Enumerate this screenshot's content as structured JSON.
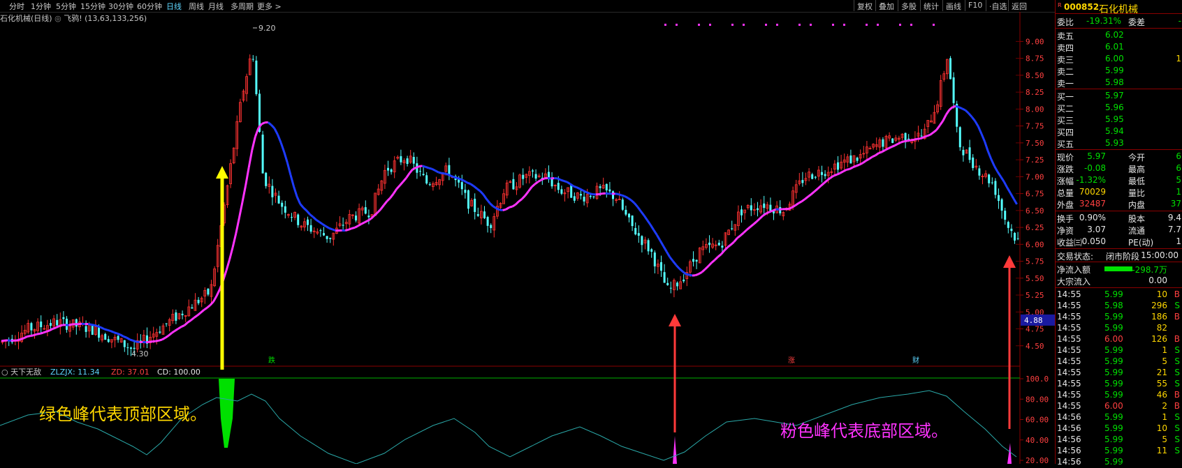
{
  "toolbar": {
    "left": [
      "分时",
      "1分钟",
      "5分钟",
      "15分钟",
      "30分钟",
      "60分钟",
      "日线",
      "周线",
      "月线",
      "多周期",
      "更多 >"
    ],
    "active": "日线",
    "right": [
      "复权",
      "叠加",
      "多股",
      "统计",
      "画线",
      "F10",
      "·自选",
      "返回"
    ]
  },
  "info": {
    "title": "石化机械(日线)",
    "indicator": "飞鸦!",
    "params": "(13,63,133,256)"
  },
  "chart_data": [
    {
      "type": "candlestick",
      "yticks": [
        4.5,
        4.75,
        5.0,
        5.25,
        5.5,
        5.75,
        6.0,
        6.25,
        6.5,
        6.75,
        7.0,
        7.25,
        7.5,
        7.75,
        8.0,
        8.25,
        8.5,
        8.75,
        9.0
      ],
      "ylim": [
        4.25,
        9.2
      ],
      "annotations": [
        {
          "text": "9.20"
        },
        {
          "text": "4.30"
        }
      ],
      "price_tag": "4.88",
      "markers": [
        "跌",
        "涨",
        "财"
      ],
      "ohlc_note": "daily candles rising from ~4.5 to 9.2 peak, falling to ~4.9 then rising to ~9.0 and falling to ~6.0"
    },
    {
      "type": "line",
      "title": "天下无敌",
      "legend": [
        {
          "label": "ZLZJX:",
          "value": "11.34",
          "color": "#5fd7ff"
        },
        {
          "label": "ZD:",
          "value": "37.01",
          "color": "#ff4040"
        },
        {
          "label": "CD:",
          "value": "100.00",
          "color": "#e6e6e6"
        }
      ],
      "yticks": [
        20.0,
        40.0,
        60.0,
        80.0,
        100.0
      ],
      "ylim": [
        15,
        105
      ],
      "annotations": [
        {
          "text": "绿色峰代表顶部区域。",
          "color": "#ffd700"
        },
        {
          "text": "粉色峰代表底部区域。",
          "color": "#ff33ff"
        }
      ]
    }
  ],
  "panel": {
    "code": "000852",
    "name": "石化机械",
    "badge": "R",
    "weibi": {
      "label": "委比",
      "value": "-19.31%",
      "label2": "委差",
      "value2": "-"
    },
    "asks": [
      {
        "label": "卖五",
        "price": "6.02",
        "vol": ""
      },
      {
        "label": "卖四",
        "price": "6.01",
        "vol": ""
      },
      {
        "label": "卖三",
        "price": "6.00",
        "vol": "1"
      },
      {
        "label": "卖二",
        "price": "5.99",
        "vol": ""
      },
      {
        "label": "卖一",
        "price": "5.98",
        "vol": ""
      }
    ],
    "bids": [
      {
        "label": "买一",
        "price": "5.97"
      },
      {
        "label": "买二",
        "price": "5.96"
      },
      {
        "label": "买三",
        "price": "5.95"
      },
      {
        "label": "买四",
        "price": "5.94"
      },
      {
        "label": "买五",
        "price": "5.93"
      }
    ],
    "stats": [
      {
        "l1": "现价",
        "v1": "5.97",
        "c1": "g",
        "l2": "今开",
        "v2": "6"
      },
      {
        "l1": "涨跌",
        "v1": "-0.08",
        "c1": "g",
        "l2": "最高",
        "v2": "6"
      },
      {
        "l1": "涨幅",
        "v1": "-1.32%",
        "c1": "g",
        "l2": "最低",
        "v2": "5"
      },
      {
        "l1": "总量",
        "v1": "70029",
        "c1": "y",
        "l2": "量比",
        "v2": "1"
      },
      {
        "l1": "外盘",
        "v1": "32487",
        "c1": "r",
        "l2": "内盘",
        "v2": "37"
      }
    ],
    "stats2": [
      {
        "l1": "换手",
        "v1": "0.90%",
        "l2": "股本",
        "v2": "9.4"
      },
      {
        "l1": "净资",
        "v1": "3.07",
        "l2": "流通",
        "v2": "7.7"
      },
      {
        "l1": "收益㈢",
        "v1": "0.050",
        "l2": "PE(动)",
        "v2": "1"
      }
    ],
    "status": {
      "label": "交易状态:",
      "value": "闭市阶段",
      "time": "15:00:00"
    },
    "flow": {
      "label": "净流入额",
      "value": "-298.7万"
    },
    "block": {
      "label": "大宗流入",
      "value": "0.00"
    },
    "ticks": [
      [
        "14:55",
        "5.99",
        "10",
        "B"
      ],
      [
        "14:55",
        "5.98",
        "296",
        "S"
      ],
      [
        "14:55",
        "5.99",
        "186",
        "B"
      ],
      [
        "14:55",
        "5.99",
        "82",
        ""
      ],
      [
        "14:55",
        "6.00",
        "126",
        "B"
      ],
      [
        "14:55",
        "5.99",
        "1",
        "S"
      ],
      [
        "14:55",
        "5.99",
        "5",
        "S"
      ],
      [
        "14:55",
        "5.99",
        "21",
        "S"
      ],
      [
        "14:55",
        "5.99",
        "55",
        "S"
      ],
      [
        "14:55",
        "5.99",
        "46",
        "B"
      ],
      [
        "14:55",
        "6.00",
        "2",
        "B"
      ],
      [
        "14:56",
        "5.99",
        "1",
        "S"
      ],
      [
        "14:56",
        "5.99",
        "10",
        "S"
      ],
      [
        "14:56",
        "5.99",
        "5",
        "S"
      ],
      [
        "14:56",
        "5.99",
        "11",
        "S"
      ],
      [
        "14:56",
        "5.99",
        "",
        ""
      ]
    ]
  },
  "colors": {
    "up": "#ff3232",
    "down": "#54ffff",
    "ma_up": "#ff33ff",
    "ma_down": "#1e3cff",
    "axis": "#8b0000"
  }
}
